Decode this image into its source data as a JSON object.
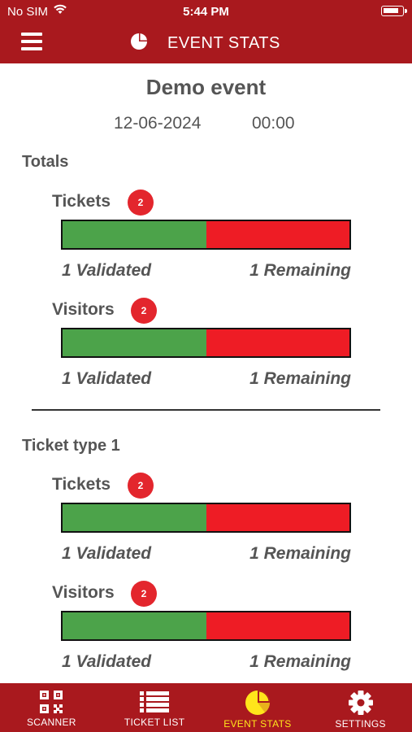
{
  "status_bar": {
    "carrier": "No SIM",
    "time": "5:44 PM"
  },
  "navbar": {
    "title": "EVENT STATS"
  },
  "event": {
    "name": "Demo event",
    "date": "12-06-2024",
    "time": "00:00"
  },
  "groups": [
    {
      "title": "Totals",
      "stats": [
        {
          "label": "Tickets",
          "count": "2",
          "validated": 1,
          "remaining": 1,
          "validated_text": "1 Validated",
          "remaining_text": "1 Remaining"
        },
        {
          "label": "Visitors",
          "count": "2",
          "validated": 1,
          "remaining": 1,
          "validated_text": "1 Validated",
          "remaining_text": "1 Remaining"
        }
      ]
    },
    {
      "title": "Ticket type 1",
      "stats": [
        {
          "label": "Tickets",
          "count": "2",
          "validated": 1,
          "remaining": 1,
          "validated_text": "1 Validated",
          "remaining_text": "1 Remaining"
        },
        {
          "label": "Visitors",
          "count": "2",
          "validated": 1,
          "remaining": 1,
          "validated_text": "1 Validated",
          "remaining_text": "1 Remaining"
        }
      ]
    }
  ],
  "colors": {
    "brand": "#a9191e",
    "validated": "#4ca34a",
    "remaining": "#ee1c25",
    "badge": "#e3262d",
    "active_tab": "#ffe51b"
  },
  "tabs": [
    {
      "label": "SCANNER",
      "icon": "qr-code-icon",
      "active": false
    },
    {
      "label": "TICKET LIST",
      "icon": "list-icon",
      "active": false
    },
    {
      "label": "EVENT STATS",
      "icon": "pie-chart-icon",
      "active": true
    },
    {
      "label": "SETTINGS",
      "icon": "gear-icon",
      "active": false
    }
  ]
}
